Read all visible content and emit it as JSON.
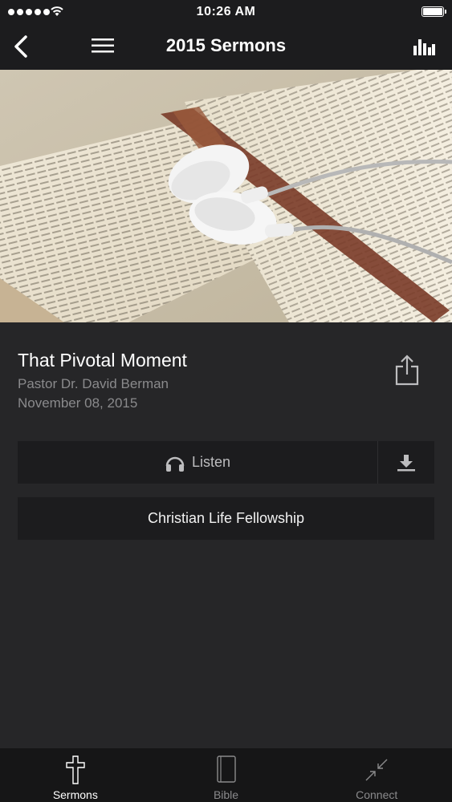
{
  "status_bar": {
    "time": "10:26 AM"
  },
  "nav": {
    "title": "2015 Sermons"
  },
  "sermon": {
    "title": "That Pivotal Moment",
    "speaker": "Pastor Dr. David Berman",
    "date": "November 08, 2015"
  },
  "actions": {
    "listen_label": "Listen",
    "church_label": "Christian Life Fellowship"
  },
  "tabs": [
    {
      "label": "Sermons",
      "icon": "cross-icon",
      "active": true
    },
    {
      "label": "Bible",
      "icon": "book-icon",
      "active": false
    },
    {
      "label": "Connect",
      "icon": "connect-arrows-icon",
      "active": false
    }
  ],
  "colors": {
    "background": "#262628",
    "bar": "#1c1c1e",
    "secondary_text": "#8a8a8c"
  }
}
